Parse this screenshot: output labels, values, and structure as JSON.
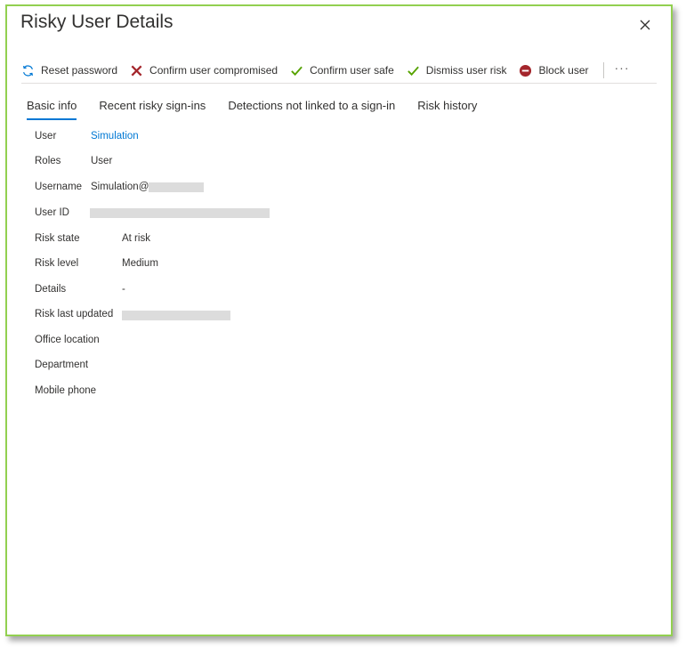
{
  "panel": {
    "title": "Risky User Details"
  },
  "toolbar": {
    "reset_password": "Reset password",
    "confirm_compromised": "Confirm user compromised",
    "confirm_safe": "Confirm user safe",
    "dismiss_risk": "Dismiss user risk",
    "block_user": "Block user",
    "more": "···"
  },
  "tabs": [
    {
      "label": "Basic info",
      "active": true
    },
    {
      "label": "Recent risky sign-ins",
      "active": false
    },
    {
      "label": "Detections not linked to a sign-in",
      "active": false
    },
    {
      "label": "Risk history",
      "active": false
    }
  ],
  "fields": {
    "user": {
      "label": "User",
      "value": "Simulation"
    },
    "roles": {
      "label": "Roles",
      "value": "User"
    },
    "username": {
      "label": "Username",
      "value": "Simulation@"
    },
    "user_id": {
      "label": "User ID",
      "value": ""
    },
    "risk_state": {
      "label": "Risk state",
      "value": "At risk"
    },
    "risk_level": {
      "label": "Risk level",
      "value": "Medium"
    },
    "details": {
      "label": "Details",
      "value": "-"
    },
    "risk_last_updated": {
      "label": "Risk last updated",
      "value": ""
    },
    "office_location": {
      "label": "Office location",
      "value": ""
    },
    "department": {
      "label": "Department",
      "value": ""
    },
    "mobile_phone": {
      "label": "Mobile phone",
      "value": ""
    }
  },
  "icons": {
    "reset": "refresh-icon",
    "compromised": "x-mark-icon",
    "safe": "checkmark-icon",
    "dismiss": "checkmark-icon",
    "block": "block-icon",
    "close": "close-icon"
  },
  "colors": {
    "frame_border": "#92d050",
    "accent": "#0078d4",
    "danger": "#a4262c",
    "success": "#57a300"
  }
}
